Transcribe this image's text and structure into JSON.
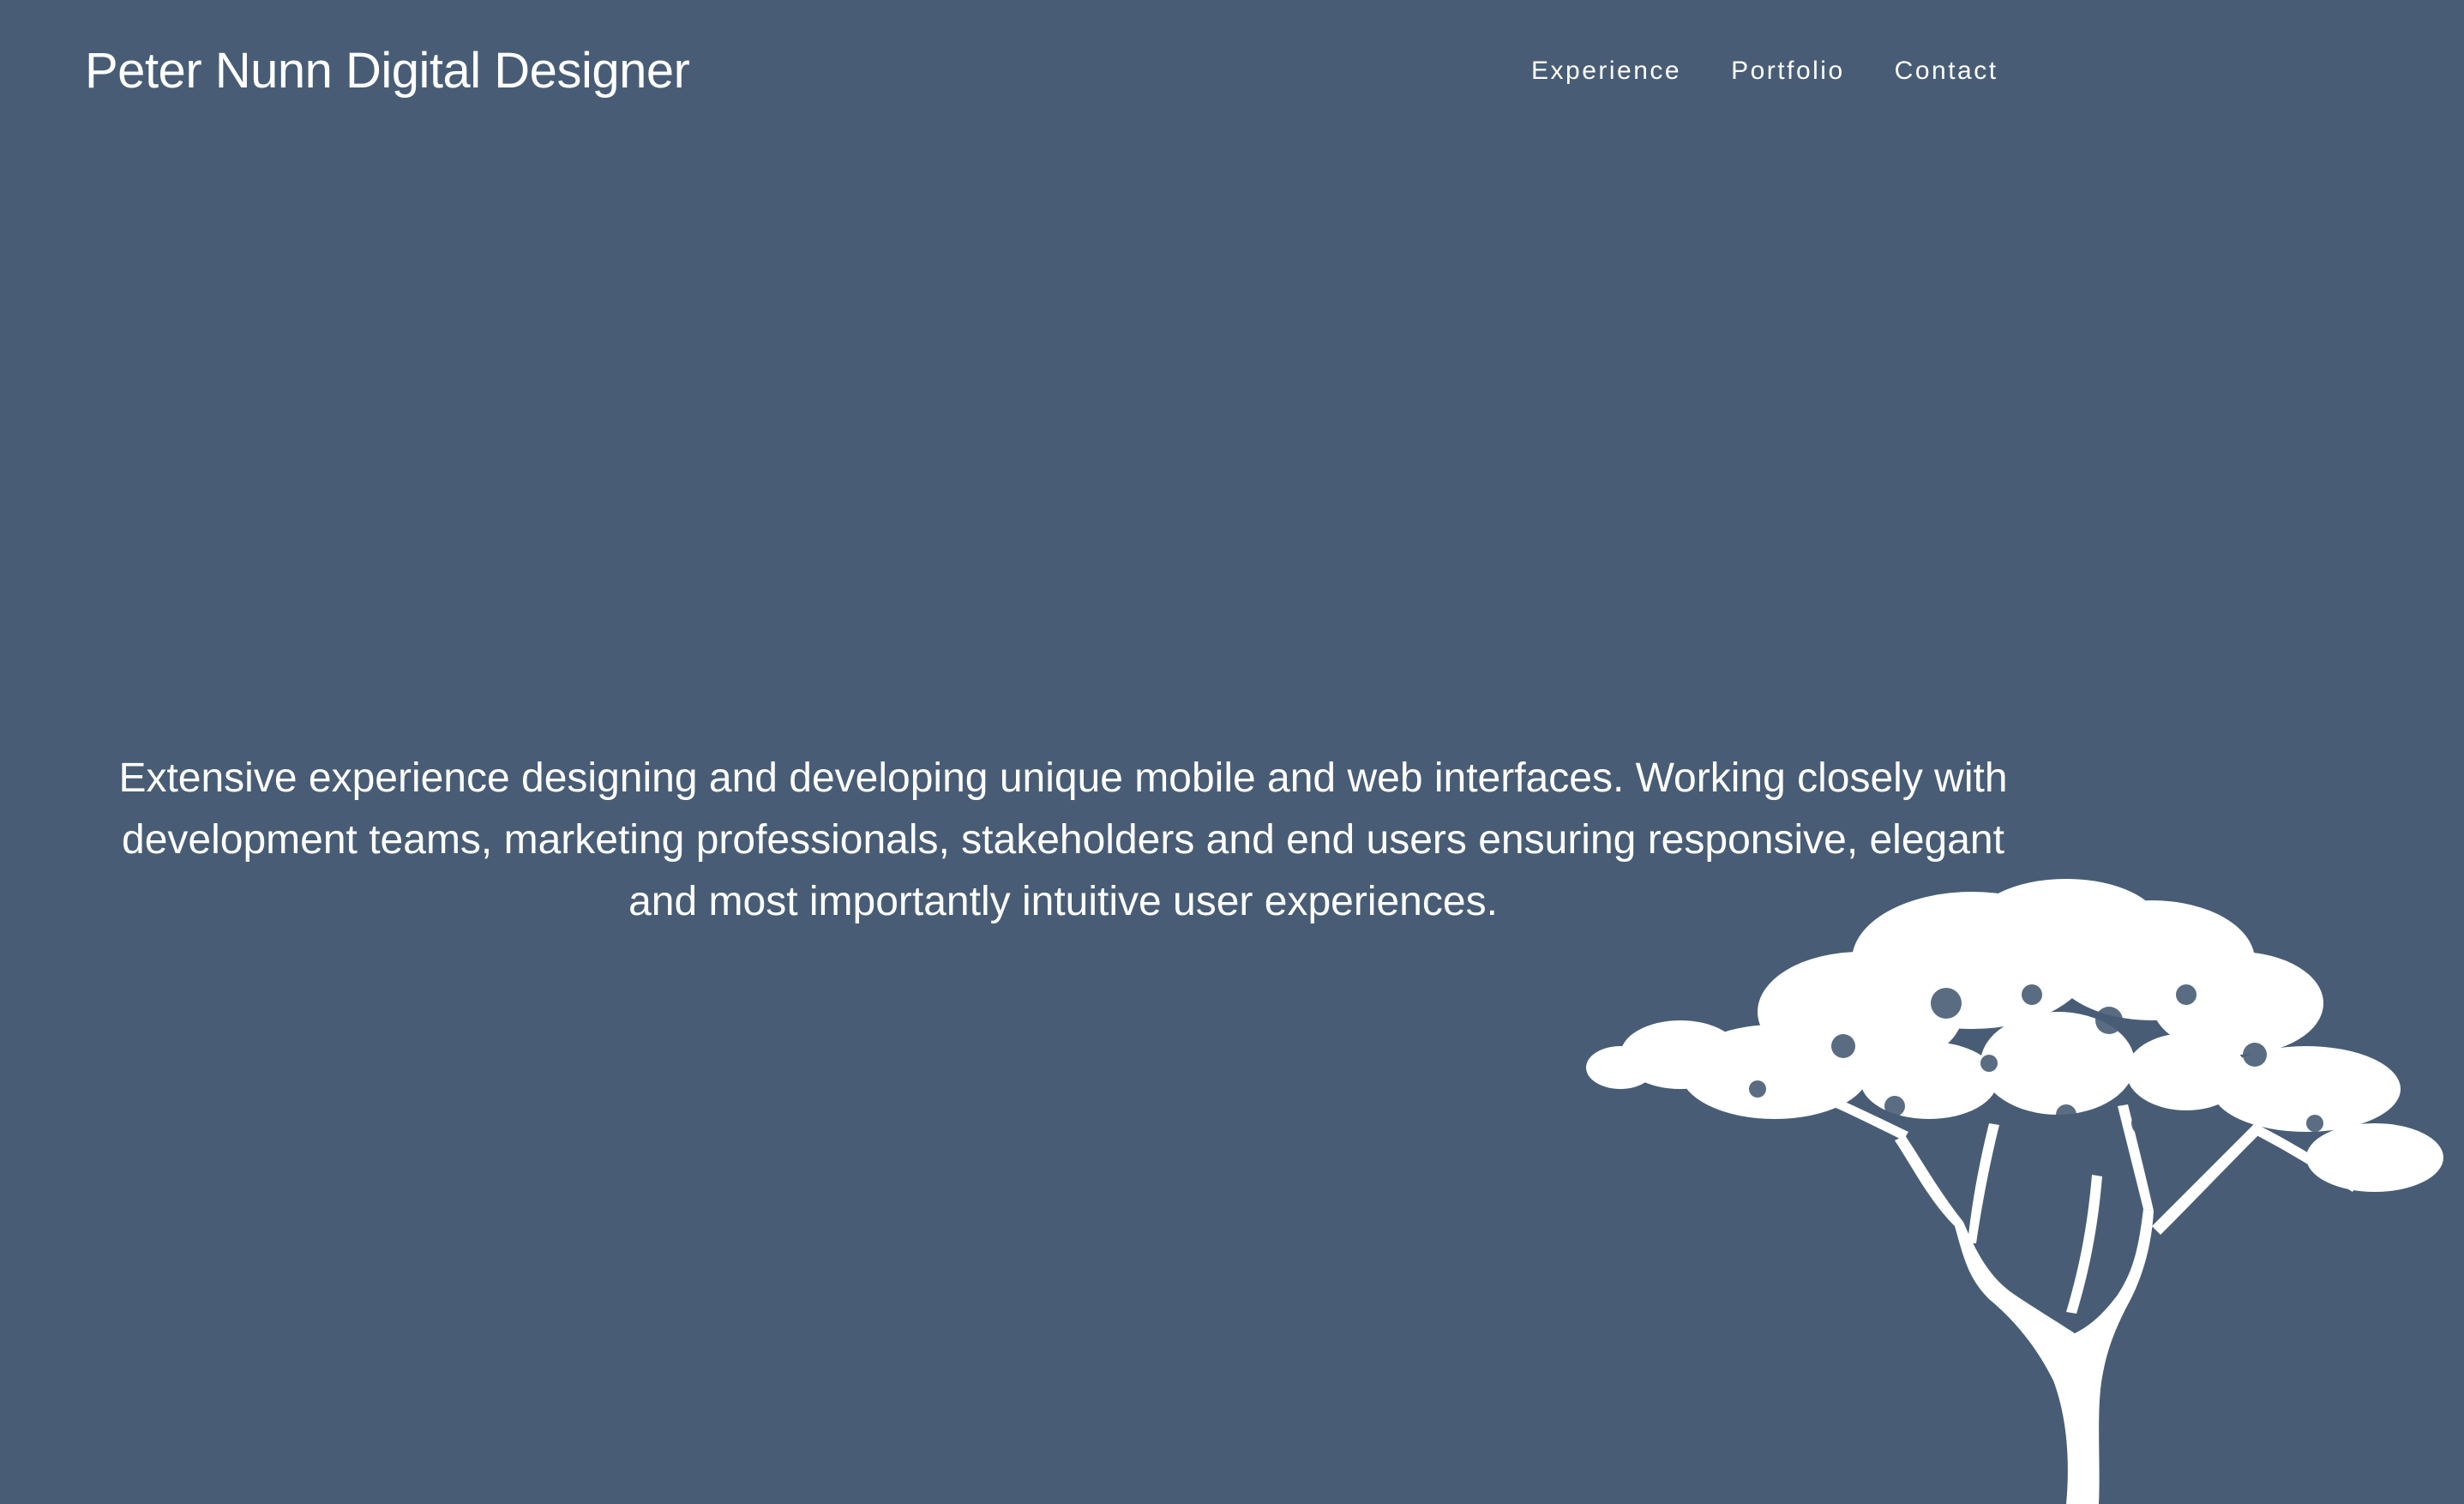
{
  "header": {
    "site_title": "Peter Nunn Digital Designer",
    "nav": [
      {
        "label": "Experience"
      },
      {
        "label": "Portfolio"
      },
      {
        "label": "Contact"
      }
    ]
  },
  "hero": {
    "intro_text": "Extensive experience designing and developing unique mobile and web interfaces. Working closely with development teams, marketing professionals, stakeholders and end users ensuring responsive, elegant and most importantly intuitive user experiences."
  },
  "colors": {
    "background": "#485d75",
    "text": "#ffffff",
    "tree": "#ffffff"
  },
  "icons": {
    "tree": "tree-silhouette"
  }
}
